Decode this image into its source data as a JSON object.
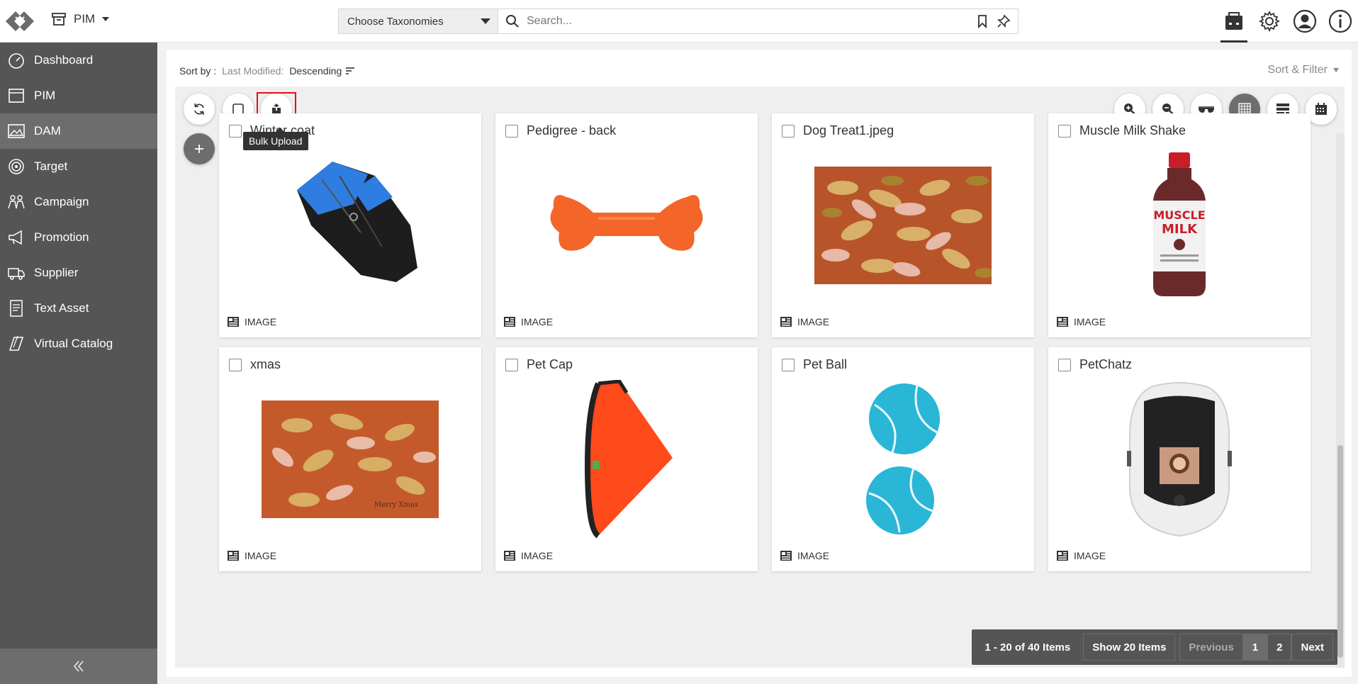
{
  "header": {
    "app_label": "PIM",
    "taxonomy_label": "Choose Taxonomies",
    "search_placeholder": "Search..."
  },
  "sidebar": {
    "items": [
      {
        "label": "Dashboard",
        "icon": "dashboard-icon"
      },
      {
        "label": "PIM",
        "icon": "pim-icon"
      },
      {
        "label": "DAM",
        "icon": "dam-icon",
        "active": true
      },
      {
        "label": "Target",
        "icon": "target-icon"
      },
      {
        "label": "Campaign",
        "icon": "campaign-icon"
      },
      {
        "label": "Promotion",
        "icon": "promotion-icon"
      },
      {
        "label": "Supplier",
        "icon": "supplier-icon"
      },
      {
        "label": "Text Asset",
        "icon": "text-asset-icon"
      },
      {
        "label": "Virtual Catalog",
        "icon": "virtual-catalog-icon"
      }
    ]
  },
  "sort": {
    "label": "Sort by :",
    "field": "Last Modified:",
    "order": "Descending",
    "filter_label": "Sort & Filter"
  },
  "toolbar": {
    "tooltip": "Bulk Upload"
  },
  "cards": [
    {
      "title": "Winter coat",
      "type": "IMAGE",
      "thumb": "dog-coat"
    },
    {
      "title": "Pedigree - back",
      "type": "IMAGE",
      "thumb": "bone"
    },
    {
      "title": "Dog Treat1.jpeg",
      "type": "IMAGE",
      "thumb": "treats"
    },
    {
      "title": "Muscle Milk Shake",
      "type": "IMAGE",
      "thumb": "muscle-milk"
    },
    {
      "title": "xmas",
      "type": "IMAGE",
      "thumb": "treats-xmas"
    },
    {
      "title": "Pet Cap",
      "type": "IMAGE",
      "thumb": "pet-cap"
    },
    {
      "title": "Pet Ball",
      "type": "IMAGE",
      "thumb": "tennis-balls"
    },
    {
      "title": "PetChatz",
      "type": "IMAGE",
      "thumb": "petchatz"
    }
  ],
  "thumb_text": {
    "muscle_brand": "MUSCLE",
    "muscle_product": "MILK",
    "xmas_caption": "Merry Xmas"
  },
  "pager": {
    "info": "1 - 20 of 40 Items",
    "show": "Show 20 Items",
    "prev": "Previous",
    "page1": "1",
    "page2": "2",
    "next": "Next"
  }
}
